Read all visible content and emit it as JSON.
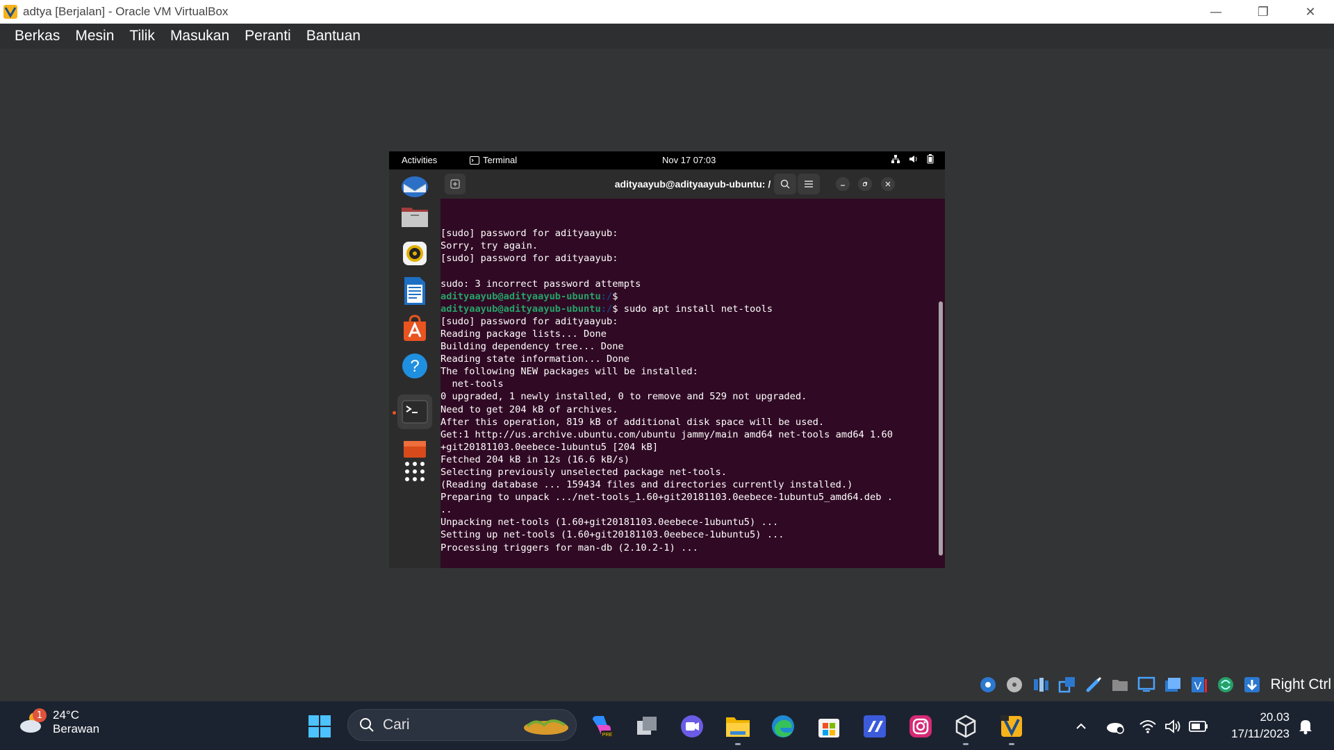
{
  "window": {
    "title": "adtya [Berjalan] - Oracle VM VirtualBox",
    "controls": {
      "minimize": "—",
      "restore": "❐",
      "close": "✕"
    }
  },
  "menubar": {
    "items": [
      "Berkas",
      "Mesin",
      "Tilik",
      "Masukan",
      "Peranti",
      "Bantuan"
    ]
  },
  "gnome": {
    "activities": "Activities",
    "app_name": "Terminal",
    "clock": "Nov 17  07:03"
  },
  "terminal": {
    "title": "adityaayub@adityaayub-ubuntu: /",
    "prompt_user": "adityaayub@adityaayub-ubuntu",
    "prompt_path": ":/",
    "lines": [
      {
        "text": "[sudo] password for adityaayub:"
      },
      {
        "text": "Sorry, try again."
      },
      {
        "text": "[sudo] password for adityaayub:"
      },
      {
        "text": ""
      },
      {
        "text": "sudo: 3 incorrect password attempts"
      },
      {
        "prompt": true,
        "cmd": "$"
      },
      {
        "prompt": true,
        "cmd": "$ sudo apt install net-tools"
      },
      {
        "text": "[sudo] password for adityaayub:"
      },
      {
        "text": "Reading package lists... Done"
      },
      {
        "text": "Building dependency tree... Done"
      },
      {
        "text": "Reading state information... Done"
      },
      {
        "text": "The following NEW packages will be installed:"
      },
      {
        "text": "  net-tools"
      },
      {
        "text": "0 upgraded, 1 newly installed, 0 to remove and 529 not upgraded."
      },
      {
        "text": "Need to get 204 kB of archives."
      },
      {
        "text": "After this operation, 819 kB of additional disk space will be used."
      },
      {
        "text": "Get:1 http://us.archive.ubuntu.com/ubuntu jammy/main amd64 net-tools amd64 1.60"
      },
      {
        "text": "+git20181103.0eebece-1ubuntu5 [204 kB]"
      },
      {
        "text": "Fetched 204 kB in 12s (16.6 kB/s)"
      },
      {
        "text": "Selecting previously unselected package net-tools."
      },
      {
        "text": "(Reading database ... 159434 files and directories currently installed.)"
      },
      {
        "text": "Preparing to unpack .../net-tools_1.60+git20181103.0eebece-1ubuntu5_amd64.deb ."
      },
      {
        "text": ".."
      },
      {
        "text": "Unpacking net-tools (1.60+git20181103.0eebece-1ubuntu5) ..."
      },
      {
        "text": "Setting up net-tools (1.60+git20181103.0eebece-1ubuntu5) ..."
      },
      {
        "text": "Processing triggers for man-db (2.10.2-1) ..."
      }
    ]
  },
  "vbox_status": {
    "host_key": "Right Ctrl"
  },
  "taskbar": {
    "weather_temp": "24°C",
    "weather_condition": "Berawan",
    "weather_badge": "1",
    "search_placeholder": "Cari",
    "time": "20.03",
    "date": "17/11/2023"
  },
  "colors": {
    "terminal_bg": "#300a24",
    "prompt_user": "#26a269",
    "prompt_path": "#12488b",
    "ubuntu_orange": "#e95420",
    "taskbar_bg": "#1c2330"
  }
}
